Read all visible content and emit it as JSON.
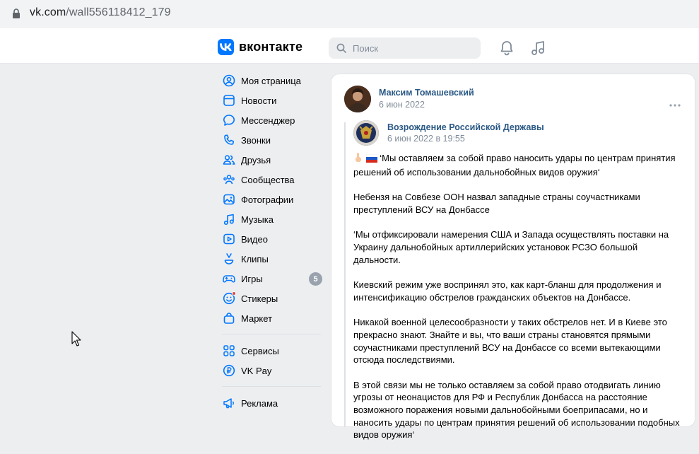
{
  "browser": {
    "url_host": "vk.com",
    "url_path": "/wall556118412_179"
  },
  "header": {
    "logo_text": "вконтакте",
    "search_placeholder": "Поиск",
    "brand_color": "#0077ff"
  },
  "sidebar": {
    "items": [
      {
        "label": "Моя страница",
        "icon": "user-circle-icon"
      },
      {
        "label": "Новости",
        "icon": "newspaper-icon"
      },
      {
        "label": "Мессенджер",
        "icon": "message-icon"
      },
      {
        "label": "Звонки",
        "icon": "phone-icon"
      },
      {
        "label": "Друзья",
        "icon": "friends-icon"
      },
      {
        "label": "Сообщества",
        "icon": "communities-icon"
      },
      {
        "label": "Фотографии",
        "icon": "photo-icon"
      },
      {
        "label": "Музыка",
        "icon": "music-icon"
      },
      {
        "label": "Видео",
        "icon": "video-icon"
      },
      {
        "label": "Клипы",
        "icon": "clips-icon"
      },
      {
        "label": "Игры",
        "icon": "gamepad-icon",
        "badge": "5"
      },
      {
        "label": "Стикеры",
        "icon": "sticker-icon"
      },
      {
        "label": "Маркет",
        "icon": "market-bag-icon"
      }
    ],
    "secondary": [
      {
        "label": "Сервисы",
        "icon": "services-grid-icon"
      },
      {
        "label": "VK Pay",
        "icon": "vkpay-icon"
      }
    ],
    "tertiary": [
      {
        "label": "Реклама",
        "icon": "megaphone-icon"
      }
    ]
  },
  "post": {
    "author": "Максим Томашевский",
    "date": "6 июн 2022",
    "repost": {
      "author": "Возрождение Российской Державы",
      "date": "6 июн 2022 в 19:55"
    },
    "paragraphs": [
      "‘Мы оставляем за собой право наносить удары по центрам принятия решений об использовании дальнобойных видов оружия‘",
      "Небензя на Совбезе ООН назвал западные страны соучастниками преступлений ВСУ на Донбассе",
      "‘Мы отфиксировали намерения США и Запада осуществлять поставки на Украину дальнобойных артиллерийских установок РСЗО большой дальности.",
      "Киевский режим уже воспринял это, как карт-бланш для продолжения и интенсификацию обстрелов гражданских объектов на Донбассе.",
      "Никакой военной целесообразности у таких обстрелов нет. И в Киеве это прекрасно знают. Знайте и вы, что ваши страны становятся прямыми соучастниками преступлений ВСУ на Донбассе со всеми вытекающими отсюда последствиями.",
      "В этой связи мы не только оставляем за собой право отодвигать линию угрозы от неонацистов для РФ и Республик Донбасса на расстояние возможного поражения новыми дальнобойными боеприпасами, но и наносить удары по центрам принятия решений об использовании подобных видов оружия‘"
    ]
  }
}
